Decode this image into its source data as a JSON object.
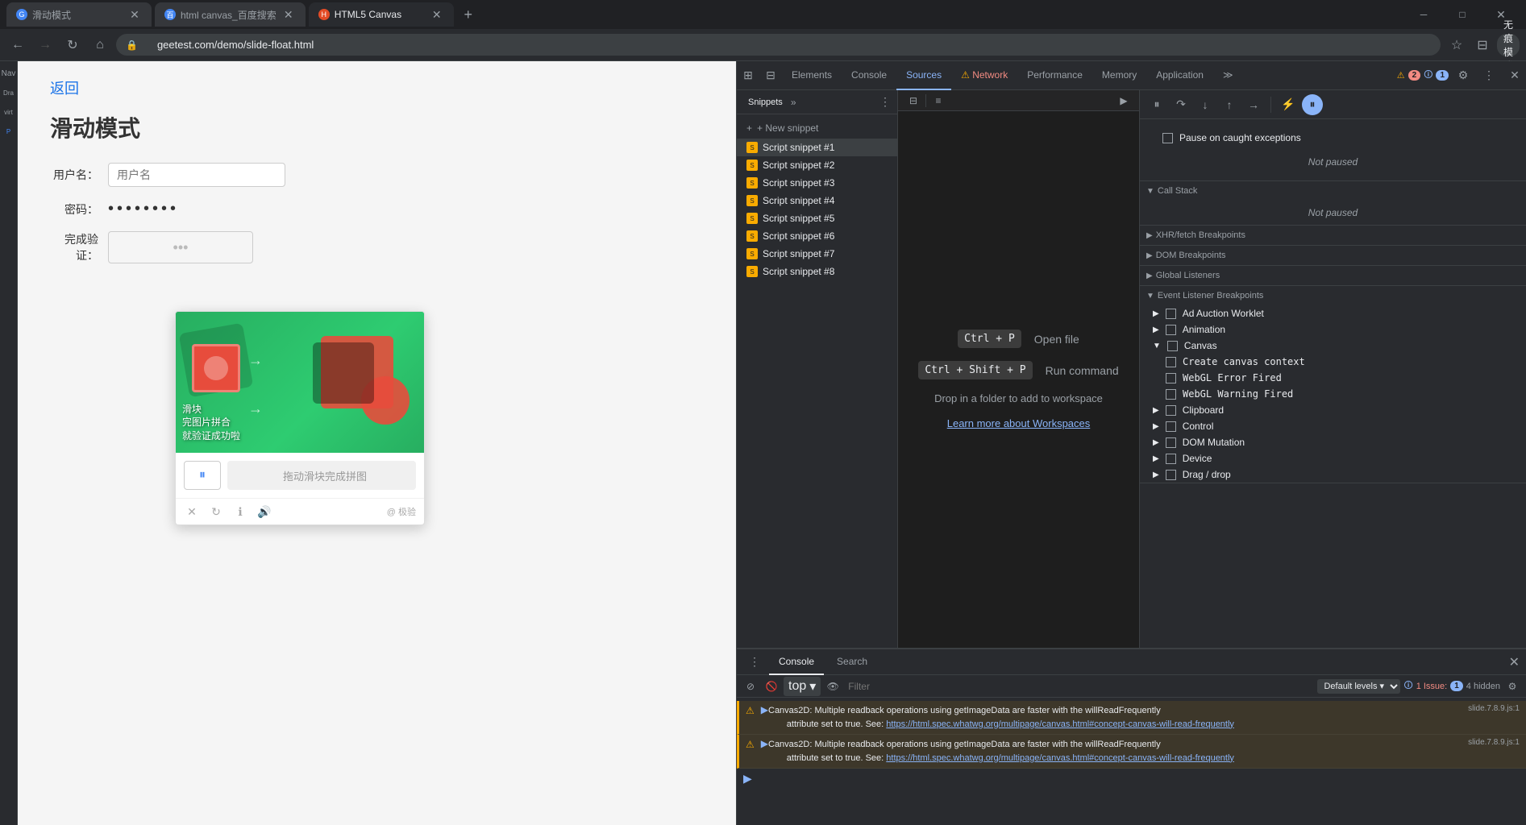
{
  "browser": {
    "tabs": [
      {
        "id": "tab1",
        "favicon_color": "#4285f4",
        "favicon_text": "G",
        "label": "滑动模式",
        "active": false
      },
      {
        "id": "tab2",
        "favicon_color": "#4285f4",
        "favicon_text": "百",
        "label": "html canvas_百度搜索",
        "active": false
      },
      {
        "id": "tab3",
        "favicon_color": "#e34c26",
        "favicon_text": "H",
        "label": "HTML5 Canvas",
        "active": true
      }
    ],
    "add_tab_label": "+",
    "url": "geetest.com/demo/slide-float.html",
    "window_controls": [
      "─",
      "□",
      "✕"
    ]
  },
  "page": {
    "back_link": "返回",
    "title": "滑动模式",
    "fields": [
      {
        "label": "用户名：",
        "placeholder": "用户名",
        "type": "text"
      },
      {
        "label": "密码：",
        "value": "••••••••",
        "type": "password"
      },
      {
        "label": "完成验证：",
        "placeholder": "",
        "type": "verify"
      }
    ],
    "captcha": {
      "image_alt": "滑块 完图片拼合 就验证成功啦",
      "slider_text": "拖动滑块完成拼图",
      "brand": "@ 极验"
    }
  },
  "devtools": {
    "tabs": [
      {
        "label": "Elements",
        "active": false
      },
      {
        "label": "Console",
        "active": false
      },
      {
        "label": "Sources",
        "active": true
      },
      {
        "label": "⚠ Network",
        "active": false
      },
      {
        "label": "Performance",
        "active": false
      },
      {
        "label": "Memory",
        "active": false
      },
      {
        "label": "Application",
        "active": false
      }
    ],
    "toolbar_icons": [
      "⊞",
      "⟳",
      "≫"
    ],
    "badges": {
      "warning": "▲ 2",
      "info": "🛈 1"
    },
    "sources": {
      "nav_tabs": [
        "Snippets"
      ],
      "add_snippet": "+ New snippet",
      "snippets": [
        {
          "label": "Script snippet #1",
          "active": true
        },
        {
          "label": "Script snippet #2",
          "active": false
        },
        {
          "label": "Script snippet #3",
          "active": false
        },
        {
          "label": "Script snippet #4",
          "active": false
        },
        {
          "label": "Script snippet #5",
          "active": false
        },
        {
          "label": "Script snippet #6",
          "active": false
        },
        {
          "label": "Script snippet #7",
          "active": false
        },
        {
          "label": "Script snippet #8",
          "active": false
        }
      ],
      "editor": {
        "shortcut1_key": "Ctrl + P",
        "shortcut1_desc": "Open file",
        "shortcut2_key": "Ctrl + Shift + P",
        "shortcut2_desc": "Run command",
        "drop_text": "Drop in a folder to add to workspace",
        "learn_more": "Learn more about Workspaces"
      }
    },
    "debugger": {
      "pause_on_exceptions": "Pause on caught exceptions",
      "not_paused": "Not paused",
      "call_stack": "Call Stack",
      "sections": [
        {
          "label": "XHR/fetch Breakpoints",
          "expanded": false
        },
        {
          "label": "DOM Breakpoints",
          "expanded": false
        },
        {
          "label": "Global Listeners",
          "expanded": false
        },
        {
          "label": "Event Listener Breakpoints",
          "expanded": true
        },
        {
          "label": "Ad Auction Worklet",
          "expanded": false
        },
        {
          "label": "Animation",
          "expanded": false
        },
        {
          "label": "Canvas",
          "expanded": true,
          "children": [
            {
              "label": "Create canvas context",
              "checked": false,
              "monospace": true
            },
            {
              "label": "WebGL Error Fired",
              "checked": false,
              "monospace": true
            },
            {
              "label": "WebGL Warning Fired",
              "checked": false,
              "monospace": true
            }
          ]
        },
        {
          "label": "Clipboard",
          "expanded": false
        },
        {
          "label": "Control",
          "expanded": false
        },
        {
          "label": "DOM Mutation",
          "expanded": false
        },
        {
          "label": "Device",
          "expanded": false
        },
        {
          "label": "Drag / drop",
          "expanded": false
        }
      ]
    },
    "console": {
      "tabs": [
        "Console",
        "Search"
      ],
      "toolbar": {
        "top_label": "top",
        "filter_placeholder": "Filter",
        "default_levels": "Default levels ▾",
        "issue_text": "1 Issue: 🛈 1",
        "hidden_text": "4 hidden"
      },
      "messages": [
        {
          "type": "warning",
          "text1": "▶ Canvas2D: Multiple readback operations using getImageData are faster with the willReadFrequently",
          "text2": " attribute set to true. See: ",
          "link": "https://html.spec.whatwg.org/multipage/canvas.html#concept-canvas-will-read-frequently",
          "file": "slide.7.8.9.js:1"
        },
        {
          "type": "warning",
          "text1": "▶ Canvas2D: Multiple readback operations using getImageData are faster with the willReadFrequently",
          "text2": " attribute set to true. See: ",
          "link": "https://html.spec.whatwg.org/multipage/canvas.html#concept-canvas-will-read-frequently",
          "file": "slide.7.8.9.js:1"
        }
      ]
    }
  }
}
